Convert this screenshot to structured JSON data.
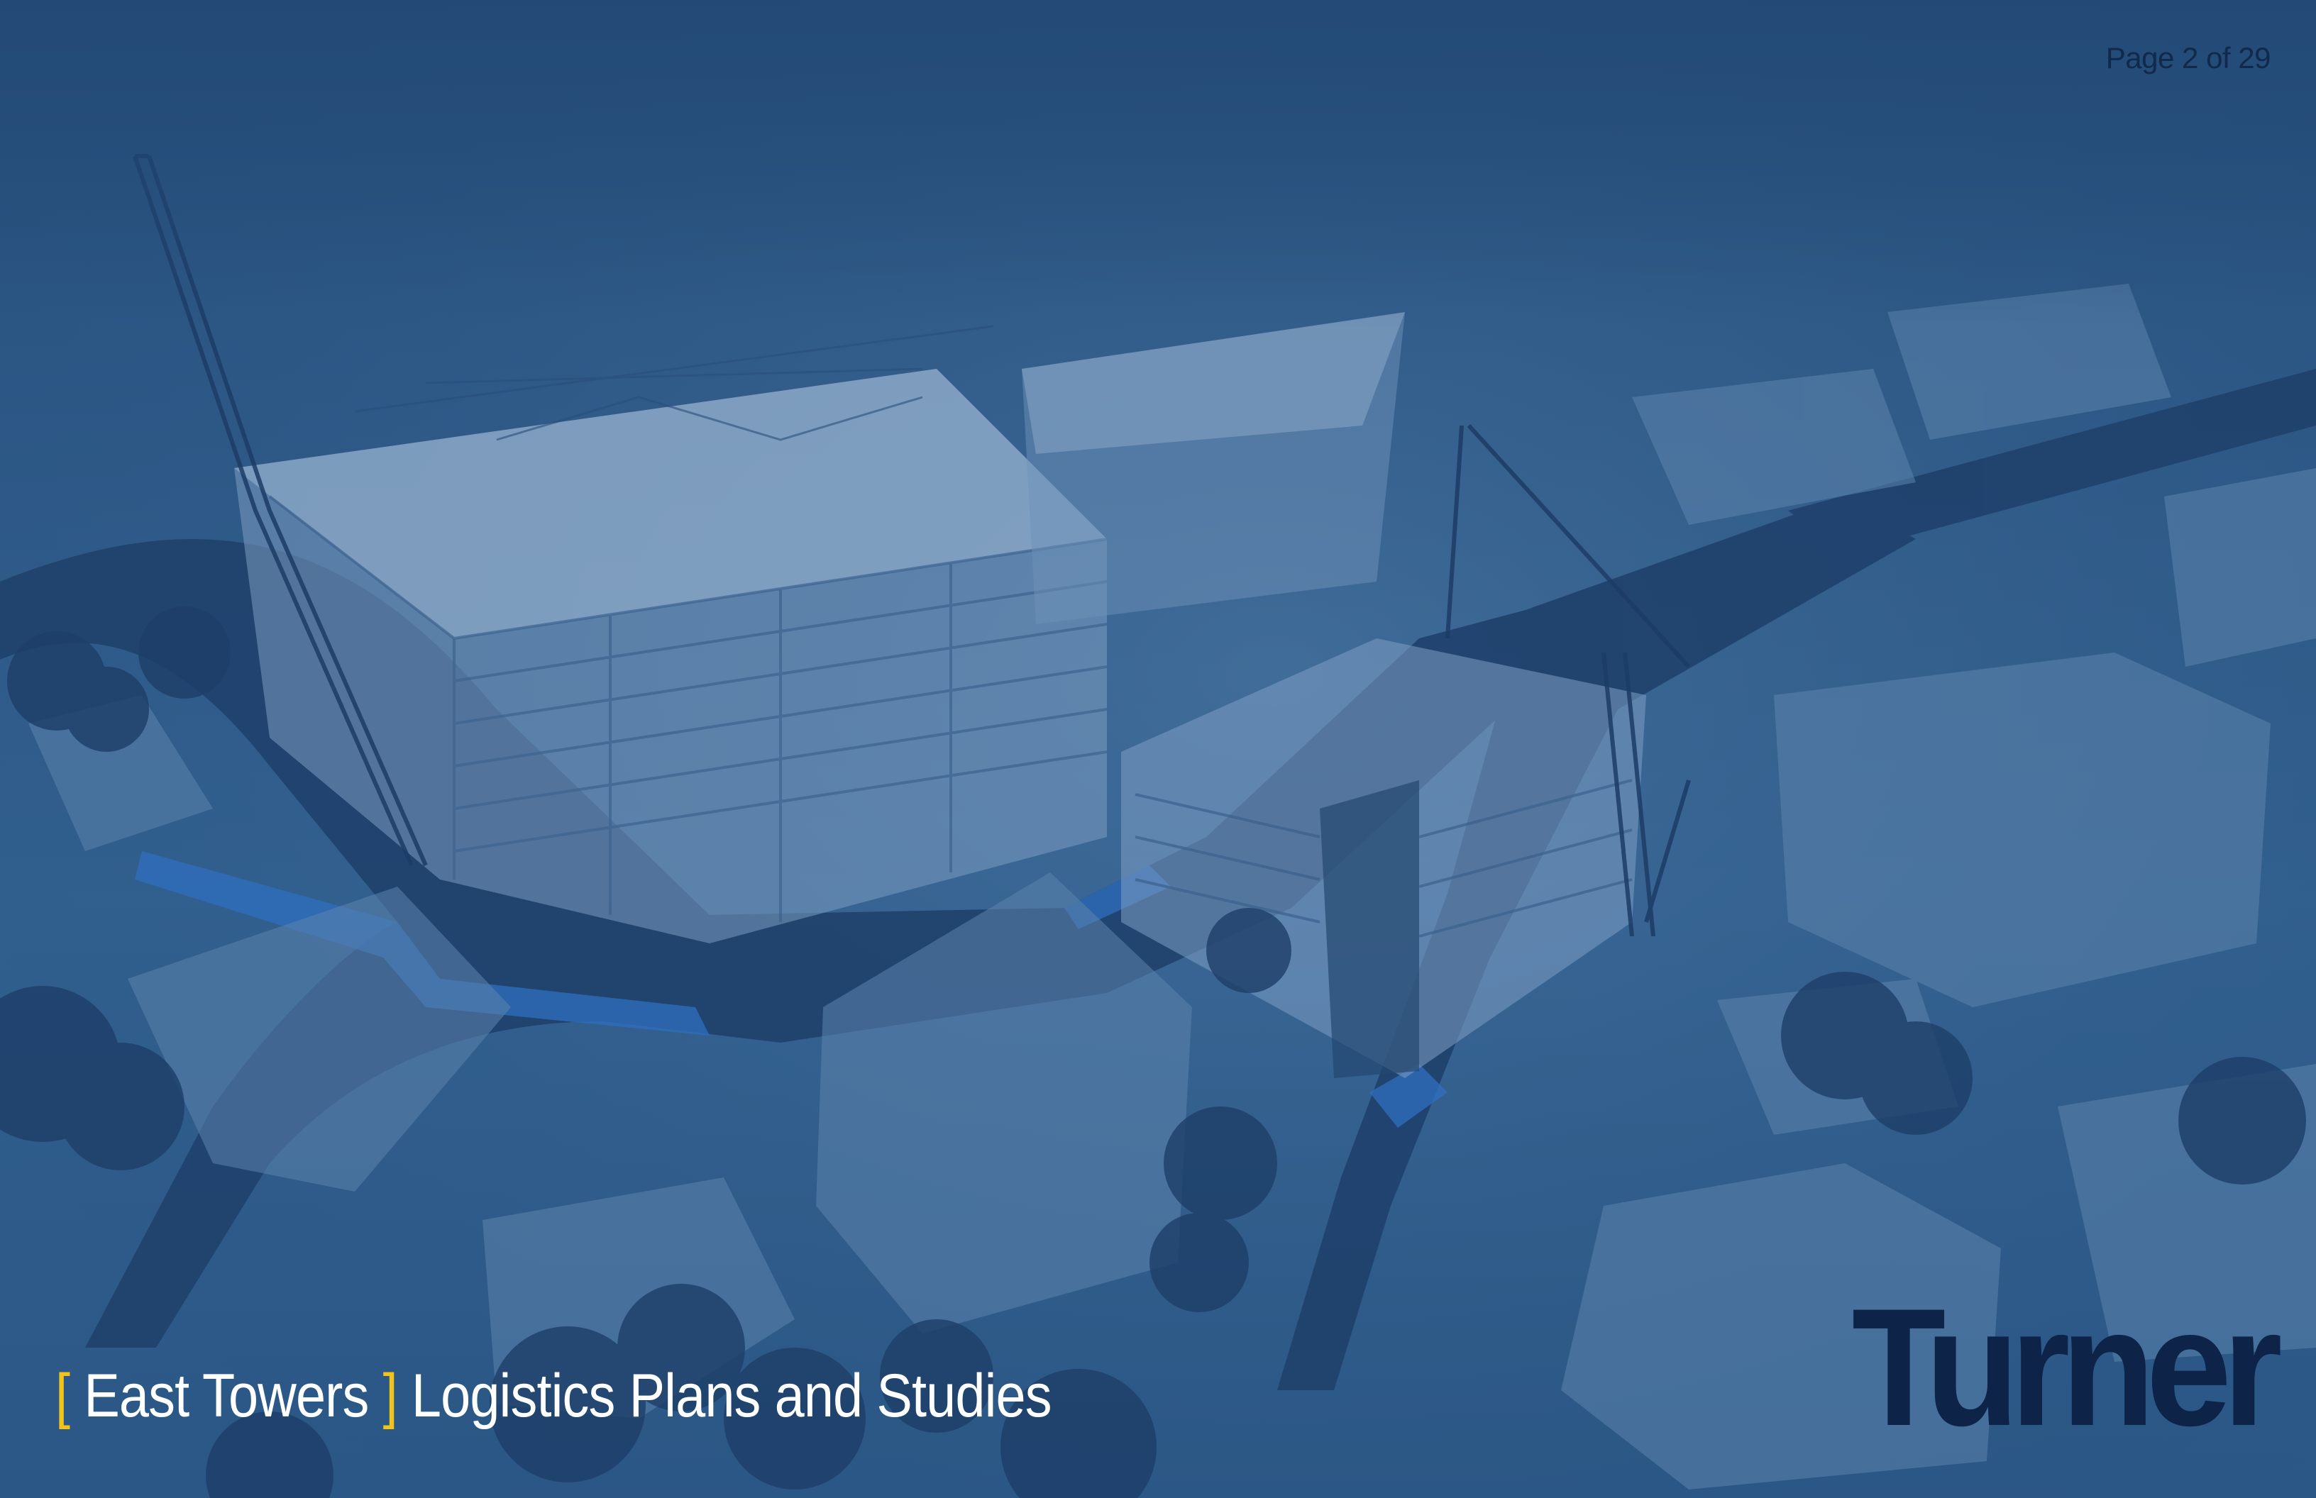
{
  "page": {
    "indicator": "Page 2 of 29"
  },
  "title": {
    "open_bracket": "[",
    "project": "East Towers",
    "close_bracket": "]",
    "subtitle": "Logistics Plans and Studies"
  },
  "logo": {
    "text": "Turner"
  },
  "colors": {
    "overlay": "#2d5988",
    "bracket_accent": "#f2c318",
    "logo": "#0d2347",
    "page_indicator": "#11294a",
    "title_text": "#ffffff"
  }
}
